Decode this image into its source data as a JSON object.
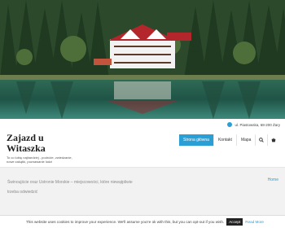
{
  "address": {
    "text": "ul. Piastowska, 68-200 Żary",
    "icon": "map-pin-icon"
  },
  "site": {
    "title": "Zajazd u Witaszka",
    "tagline": "To co lubię najbardziej - podróże, zwiedzanie, nowe zakątki, poznawanie ludzi"
  },
  "nav": {
    "items": [
      {
        "label": "Strona główna",
        "active": true
      },
      {
        "label": "Kontakt",
        "active": false
      },
      {
        "label": "Mapa",
        "active": false
      }
    ],
    "search_icon": "search-icon",
    "cart_icon": "cart-icon"
  },
  "content": {
    "lead": "Świnoujście oraz Ustronie Morskie – miejscowości, które niewątpliwie trzeba odwiedzić",
    "breadcrumb": "Home"
  },
  "cookie": {
    "message": "This website uses cookies to improve your experience. We'll assume you're ok with this, but you can opt-out if you wish.",
    "accept_label": "Accept",
    "read_more_label": "Read More"
  },
  "colors": {
    "accent": "#2a9fd6",
    "dark": "#222222"
  }
}
